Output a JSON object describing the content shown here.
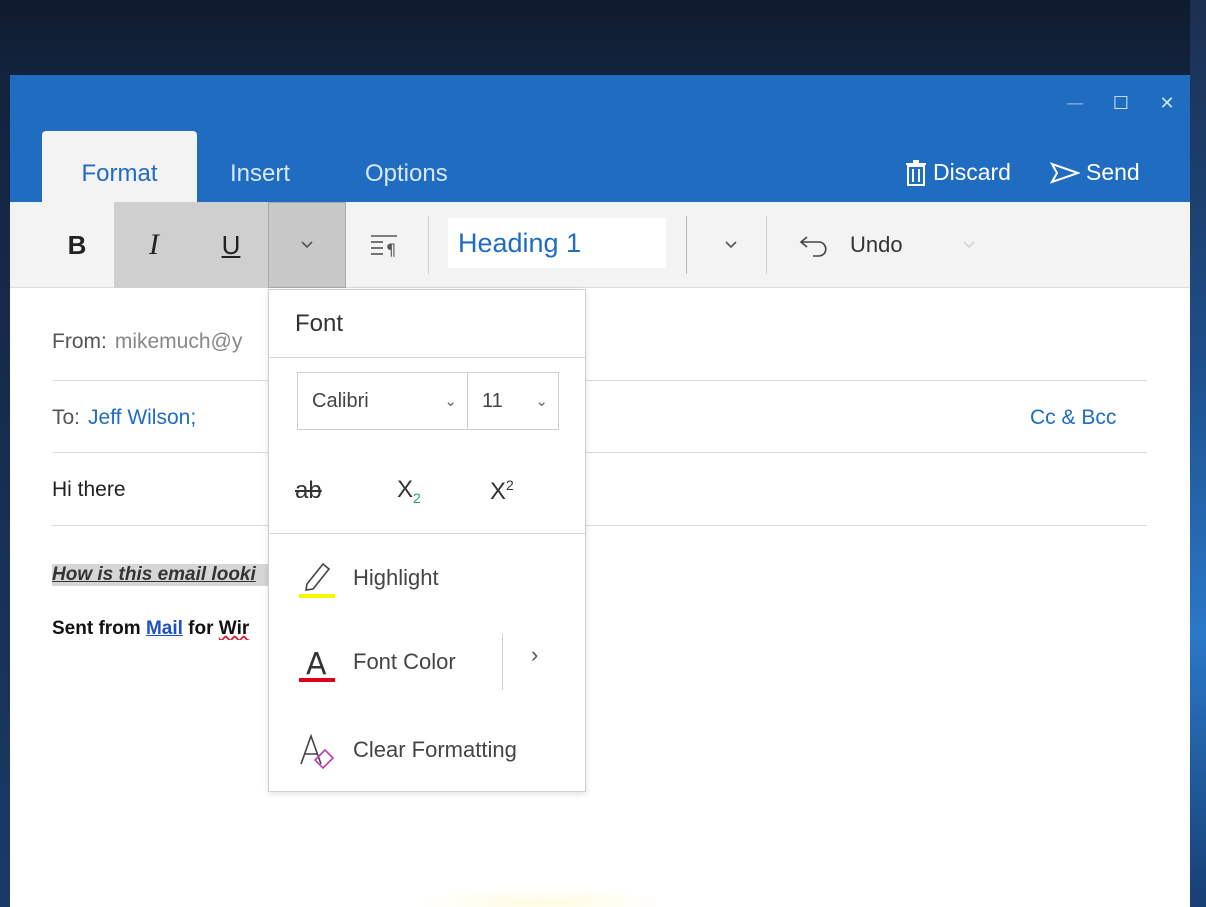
{
  "window": {
    "controls": {
      "minimize": "—",
      "maximize": "☐",
      "close": "✕"
    }
  },
  "tabs": [
    {
      "label": "Format",
      "active": true
    },
    {
      "label": "Insert",
      "active": false
    },
    {
      "label": "Options",
      "active": false
    }
  ],
  "actions": {
    "discard": "Discard",
    "send": "Send"
  },
  "toolbar": {
    "bold": "B",
    "italic": "I",
    "underline": "U",
    "style_value": "Heading 1",
    "undo": "Undo"
  },
  "compose": {
    "from_label": "From:",
    "from_value": "mikemuch@y",
    "to_label": "To:",
    "to_value": "Jeff Wilson;",
    "cc_bcc": "Cc & Bcc",
    "subject": "Hi there",
    "body_line": "How is this email looki",
    "signature_prefix": "Sent from ",
    "signature_link": "Mail",
    "signature_mid": " for ",
    "signature_suffix": "Wir"
  },
  "font_menu": {
    "title": "Font",
    "font_name": "Calibri",
    "font_size": "11",
    "strikethrough": "ab",
    "subscript_base": "X",
    "subscript_mark": "2",
    "superscript_base": "X",
    "superscript_mark": "2",
    "highlight": "Highlight",
    "font_color": "Font Color",
    "font_color_glyph": "A",
    "more": "›",
    "clear_formatting": "Clear Formatting"
  },
  "colors": {
    "accent": "#1f6cc1",
    "highlight": "#f7f700",
    "font_color": "#e0001b"
  }
}
